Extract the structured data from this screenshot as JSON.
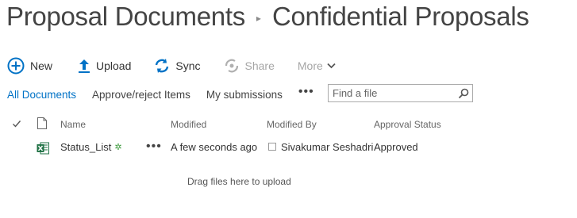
{
  "breadcrumb": {
    "parent": "Proposal Documents",
    "current": "Confidential Proposals"
  },
  "commands": {
    "new_label": "New",
    "upload_label": "Upload",
    "sync_label": "Sync",
    "share_label": "Share",
    "more_label": "More"
  },
  "views": {
    "all_documents": "All Documents",
    "approve_reject": "Approve/reject Items",
    "my_submissions": "My submissions",
    "ellipsis": "•••"
  },
  "search": {
    "placeholder": "Find a file"
  },
  "columns": {
    "name": "Name",
    "modified": "Modified",
    "modified_by": "Modified By",
    "approval_status": "Approval Status"
  },
  "rows": [
    {
      "name": "Status_List",
      "new_marker": "✲",
      "menu": "•••",
      "modified": "A few seconds ago",
      "modified_by": "Sivakumar Seshadri",
      "approval_status": "Approved"
    }
  ],
  "drag_hint": "Drag files here to upload",
  "colors": {
    "accent": "#0072c6",
    "disabled": "#a6a6a6",
    "excel_green": "#207245"
  }
}
